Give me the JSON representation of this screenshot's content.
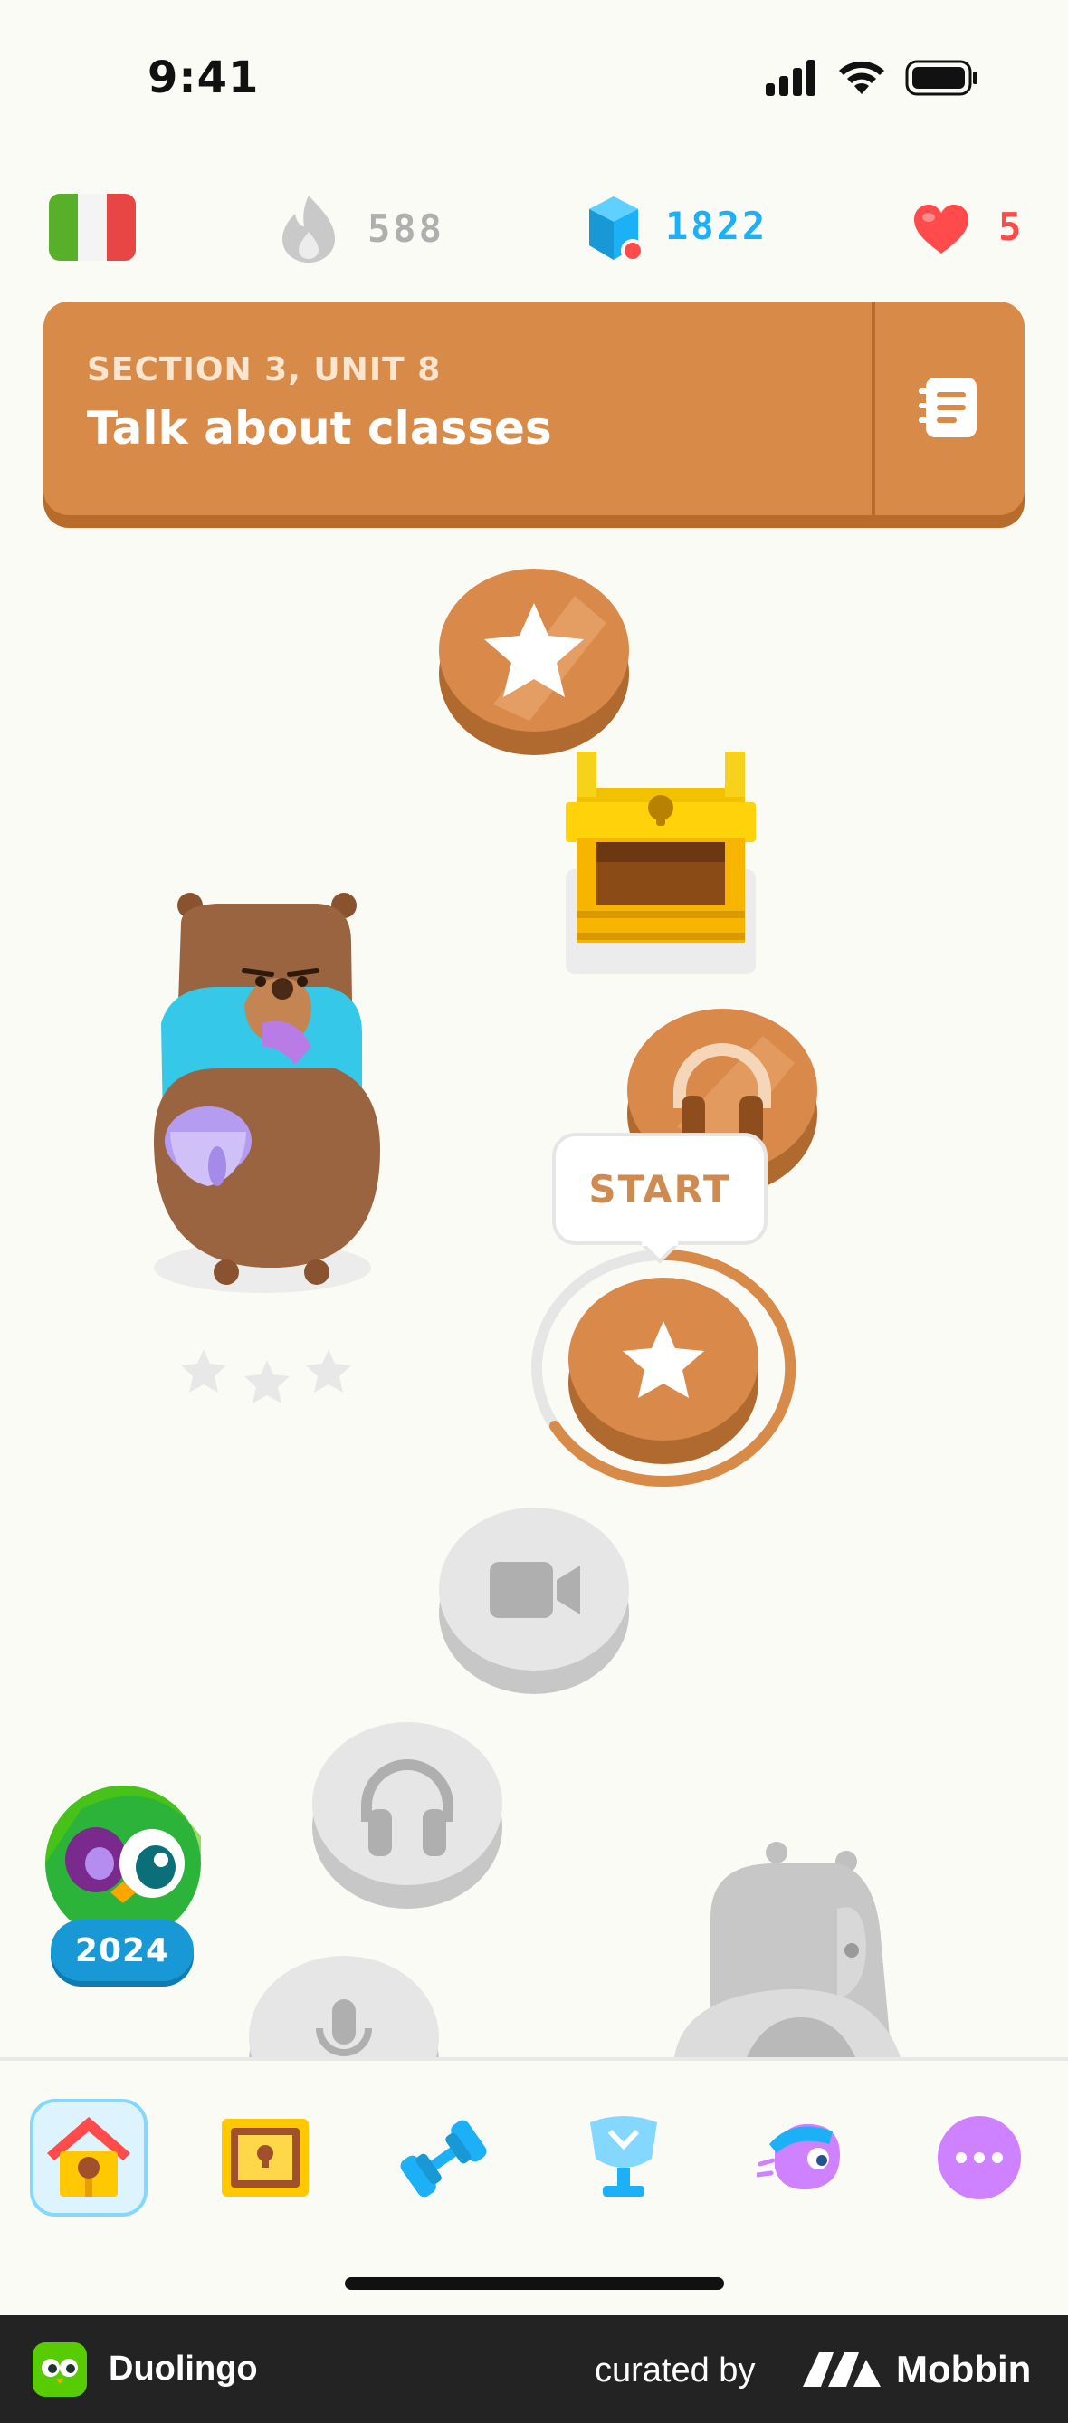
{
  "status_bar": {
    "time": "9:41"
  },
  "top_stats": {
    "course_flag": "italian-flag-icon",
    "streak": "588",
    "gems": "1822",
    "hearts": "5"
  },
  "unit_banner": {
    "section": "SECTION 3, UNIT 8",
    "title": "Talk about classes"
  },
  "path": {
    "start_label": "START",
    "badge_year": "2024"
  },
  "tabs": [
    "home-icon",
    "treasure-icon",
    "practice-dumbbell-icon",
    "leaderboard-trophy-icon",
    "quests-icon",
    "more-icon"
  ],
  "footer": {
    "app_name": "Duolingo",
    "curated_by": "curated by",
    "brand": "Mobbin"
  },
  "colors": {
    "unit_orange": "#d88a48",
    "gem_blue": "#1cb0f6",
    "heart_red": "#ff4b4b",
    "locked_gray": "#e5e5e5"
  }
}
